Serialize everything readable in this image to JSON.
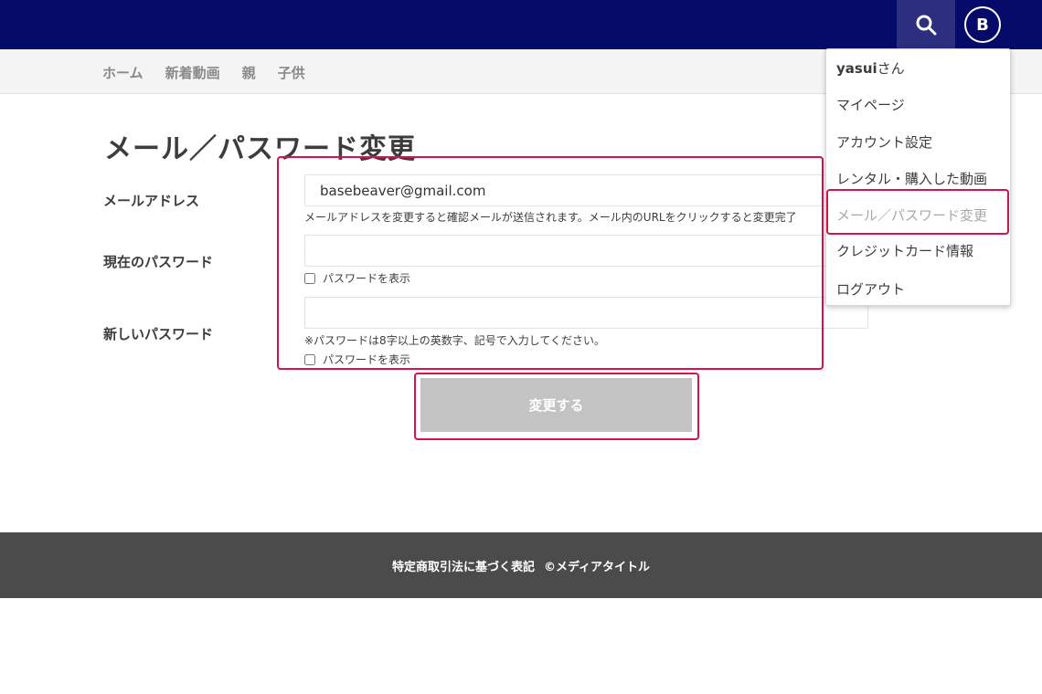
{
  "header": {
    "search_icon": "search-icon",
    "avatar_initial": "B",
    "bg_color": "#060a68"
  },
  "nav": {
    "items": [
      "ホーム",
      "新着動画",
      "親",
      "子供"
    ]
  },
  "form": {
    "title": "メール／パスワード変更",
    "email_label": "メールアドレス",
    "email_value": "basebeaver@gmail.com",
    "email_note": "メールアドレスを変更すると確認メールが送信されます。メール内のURLをクリックすると変更完了",
    "current_password_label": "現在のパスワード",
    "show_password_label": "パスワードを表示",
    "new_password_label": "新しいパスワード",
    "password_rule_note": "※パスワードは8字以上の英数字、記号で入力してください。",
    "submit_label": "変更する",
    "highlight_color": "#d4144a"
  },
  "dropdown": {
    "username": "yasui",
    "username_suffix": "さん",
    "items": [
      "マイページ",
      "アカウント設定",
      "レンタル・購入した動画",
      "メール／パスワード変更",
      "クレジットカード情報",
      "ログアウト"
    ],
    "current_index": 3
  },
  "footer": {
    "legal_link": "特定商取引法に基づく表記",
    "copyright": "©メディアタイトル"
  }
}
